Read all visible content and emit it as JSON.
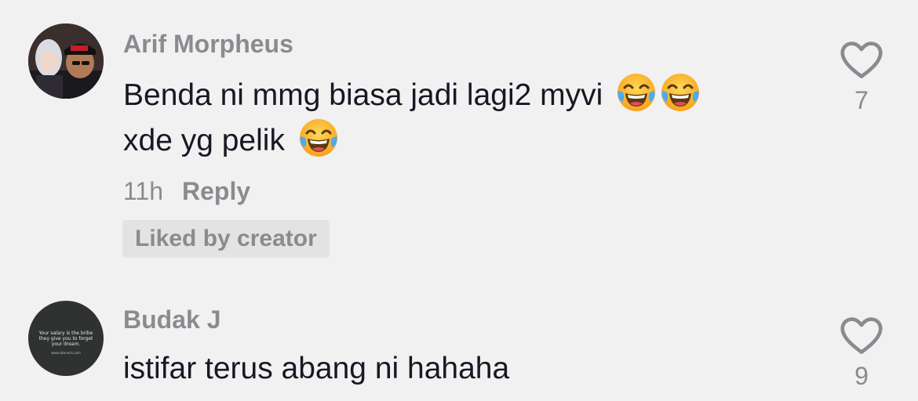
{
  "comments": [
    {
      "username": "Arif Morpheus",
      "line1": "Benda ni mmg biasa jadi lagi2 myvi",
      "line2": "xde yg pelik",
      "time": "11h",
      "reply_label": "Reply",
      "badge": "Liked by creator",
      "like_count": "7",
      "avatar_icon": "user-avatar-photo"
    },
    {
      "username": "Budak J",
      "line1": "istifar terus abang ni hahaha",
      "like_count": "9",
      "avatar_text": "Your salary is the bribe they give you to forget your dream.",
      "avatar_small": "www.sitenaris.com"
    }
  ],
  "emoji_name": "face-with-tears-of-joy-emoji",
  "colors": {
    "background": "#f1f1f1",
    "primary_text": "#161823",
    "secondary_text": "#8a8b91",
    "badge_bg": "#e3e3e4"
  }
}
